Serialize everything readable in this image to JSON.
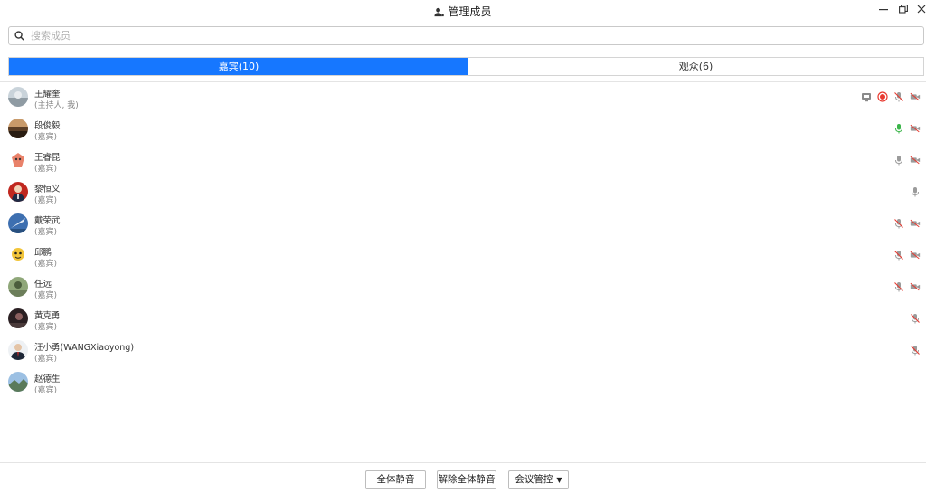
{
  "window": {
    "title": "管理成员"
  },
  "search": {
    "placeholder": "搜索成员",
    "value": ""
  },
  "tabs": [
    {
      "label": "嘉宾(10)",
      "active": true
    },
    {
      "label": "观众(6)",
      "active": false
    }
  ],
  "members": [
    {
      "name": "王耀奎",
      "role": "(主持人, 我)",
      "avatar_color": "#9aa8b2",
      "icons": [
        "screen-share-icon",
        "record-icon",
        "mic-muted-icon",
        "camera-off-icon"
      ]
    },
    {
      "name": "段俊毅",
      "role": "(嘉宾)",
      "avatar_color": "#7a5a3a",
      "icons": [
        "mic-active-icon",
        "camera-off-icon"
      ]
    },
    {
      "name": "王睿昆",
      "role": "(嘉宾)",
      "avatar_color": "#e9826a",
      "icons": [
        "mic-icon",
        "camera-off-icon"
      ]
    },
    {
      "name": "黎恒义",
      "role": "(嘉宾)",
      "avatar_color": "#c0271f",
      "icons": [
        "mic-icon"
      ]
    },
    {
      "name": "戴荣武",
      "role": "(嘉宾)",
      "avatar_color": "#3d6fb0",
      "icons": [
        "mic-muted-icon",
        "camera-off-icon"
      ]
    },
    {
      "name": "邱鹏",
      "role": "(嘉宾)",
      "avatar_color": "#f2c53a",
      "icons": [
        "mic-muted-icon",
        "camera-off-icon"
      ]
    },
    {
      "name": "任远",
      "role": "(嘉宾)",
      "avatar_color": "#5f7a4d",
      "icons": [
        "mic-muted-icon",
        "camera-off-icon"
      ]
    },
    {
      "name": "黄克勇",
      "role": "(嘉宾)",
      "avatar_color": "#3a2a2a",
      "icons": [
        "mic-muted-icon"
      ]
    },
    {
      "name": "汪小勇(WANGXiaoyong)",
      "role": "(嘉宾)",
      "avatar_color": "#d7dde4",
      "icons": [
        "mic-muted-icon"
      ]
    },
    {
      "name": "赵德生",
      "role": "(嘉宾)",
      "avatar_color": "#7fa2c9",
      "icons": []
    }
  ],
  "footer": {
    "mute_all": "全体静音",
    "unmute_all": "解除全体静音",
    "meeting_control": "会议管控"
  },
  "colors": {
    "accent": "#1677ff",
    "mic_active": "#3bb54a",
    "record": "#e8392f",
    "icon_gray": "#9b9b9b",
    "muted_slash": "#e8392f"
  }
}
